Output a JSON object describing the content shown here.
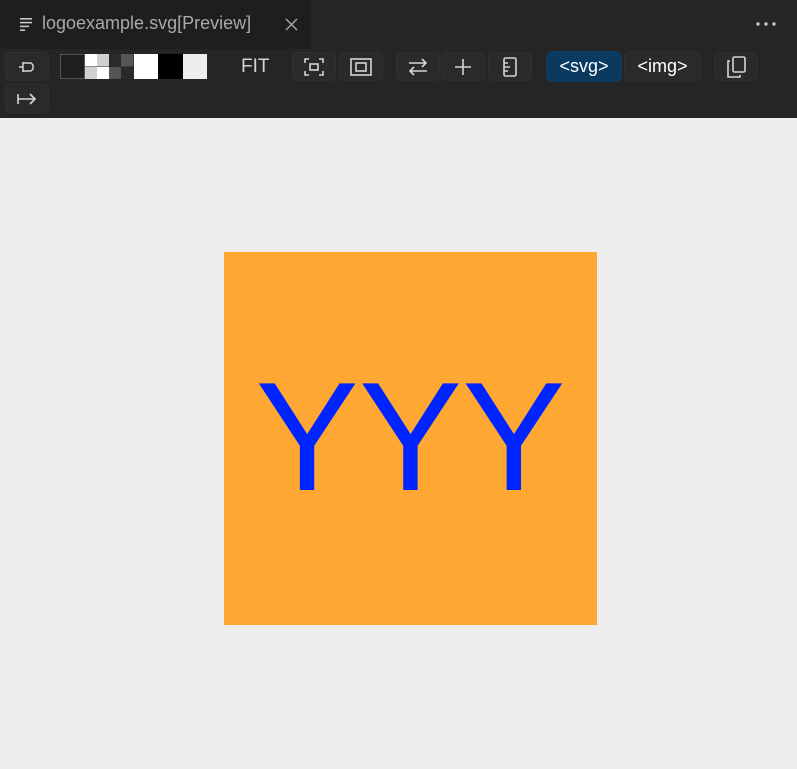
{
  "tab": {
    "title": "logoexample.svg[Preview]",
    "icon": "lines-file-icon"
  },
  "toolbar": {
    "fit_label": "FIT",
    "svg_label": "<svg>",
    "img_label": "<img>",
    "background_swatches": [
      "dark",
      "checker-light",
      "checker-dark",
      "white",
      "black",
      "light-gray"
    ]
  },
  "preview": {
    "text": "YYY",
    "background_color": "#ffa733",
    "text_color": "#0024ff"
  },
  "colors": {
    "editor_background": "#eeeeee",
    "toolbar_background": "#252526",
    "active_button": "#0a3a5f"
  }
}
